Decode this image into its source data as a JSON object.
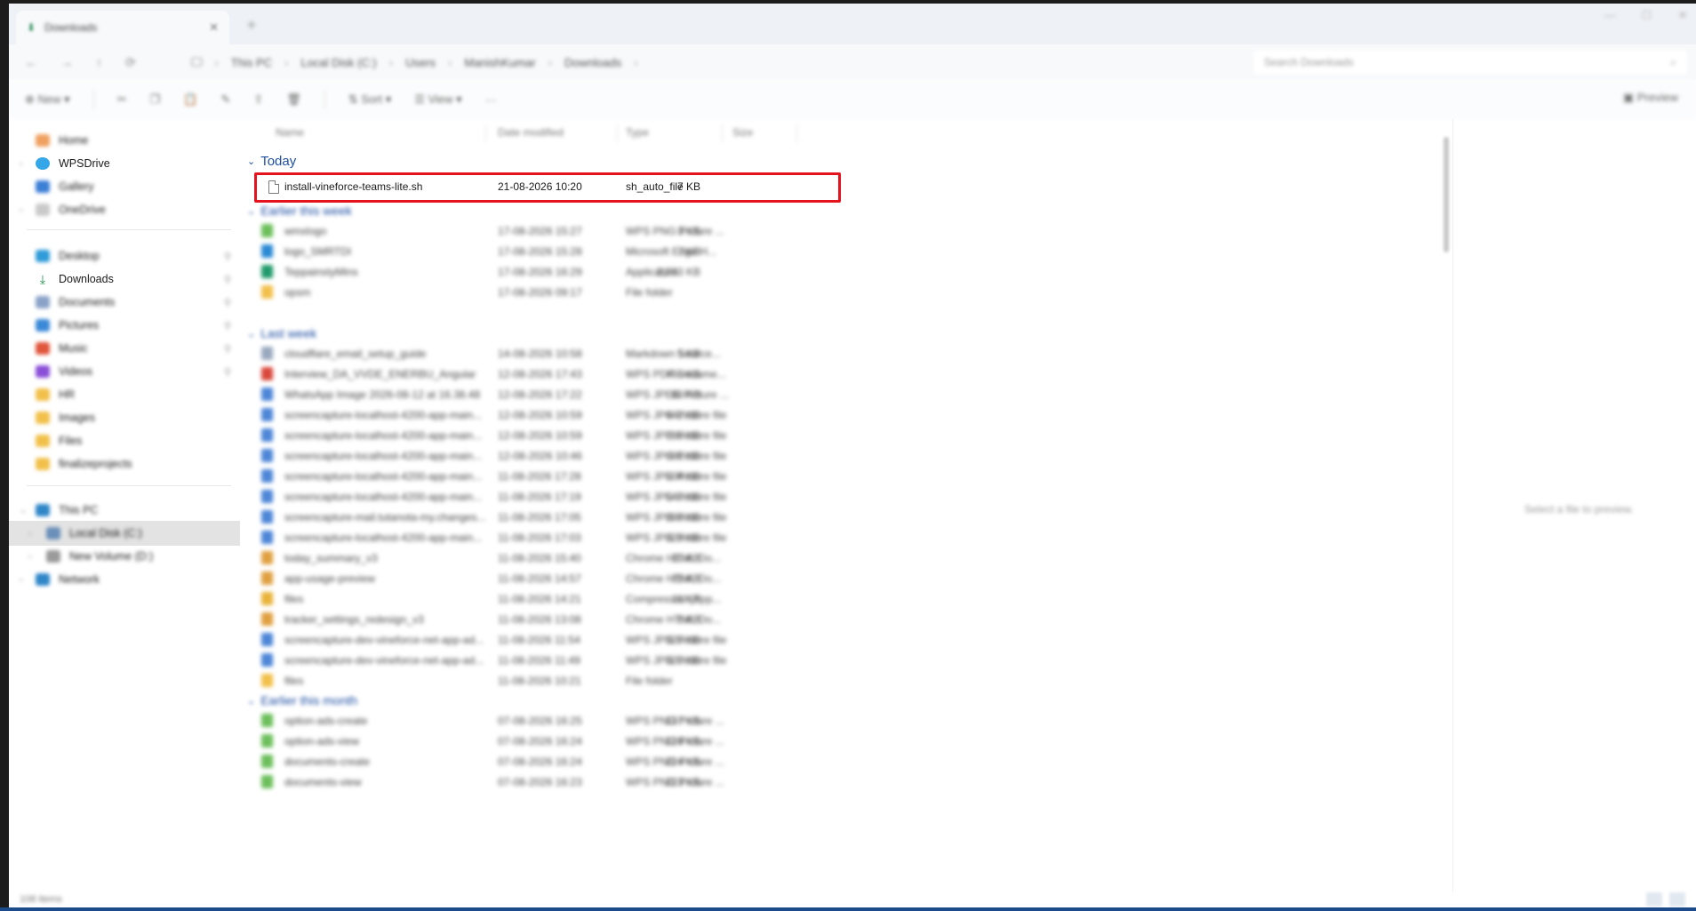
{
  "window": {
    "tab_title": "Downloads",
    "tab_close": "✕",
    "new_tab": "+",
    "controls": [
      "—",
      "☐",
      "✕"
    ]
  },
  "address": {
    "nav": [
      "←",
      "→",
      "↑",
      "⟳"
    ],
    "breadcrumb": [
      "This PC",
      "Local Disk (C:)",
      "Users",
      "ManishKumar",
      "Downloads"
    ],
    "search_placeholder": "Search Downloads"
  },
  "commands": {
    "new": "New",
    "sort": "Sort",
    "view": "View",
    "more": "···",
    "preview": "Preview"
  },
  "sidebar": {
    "home": "Home",
    "wpsdrive": "WPSDrive",
    "gallery": "Gallery",
    "onedrive": "OneDrive",
    "desktop": "Desktop",
    "downloads": "Downloads",
    "documents": "Documents",
    "pictures": "Pictures",
    "music": "Music",
    "videos": "Videos",
    "hr": "HR",
    "images": "Images",
    "files": "Files",
    "finalproject": "finalizeprojects",
    "thispc": "This PC",
    "localdisk": "Local Disk (C:)",
    "newvolume": "New Volume (D:)",
    "network": "Network"
  },
  "columns": {
    "name": "Name",
    "date": "Date modified",
    "type": "Type",
    "size": "Size"
  },
  "groups": {
    "today": "Today",
    "earlier_week": "Earlier this week",
    "last_week": "Last week",
    "earlier_month": "Earlier this month"
  },
  "today_file": {
    "name": "install-vineforce-teams-lite.sh",
    "date": "21-08-2026 10:20",
    "type": "sh_auto_file",
    "size": "7 KB"
  },
  "earlier_week_files": [
    {
      "name": "wmxlogo",
      "date": "17-08-2026 15:27",
      "type": "WPS PNG Picture ...",
      "size": "3 KB"
    },
    {
      "name": "logo_SMRTDI",
      "date": "17-08-2026 15:28",
      "type": "Microsoft Edge H...",
      "size": "7 KB"
    },
    {
      "name": "TeppainstyMins",
      "date": "17-08-2026 16:29",
      "type": "Application",
      "size": "2,233 KB"
    },
    {
      "name": "opsm",
      "date": "17-08-2026 09:17",
      "type": "File folder",
      "size": ""
    }
  ],
  "last_week_files": [
    {
      "name": "cloudflare_email_setup_guide",
      "date": "14-08-2026 10:58",
      "type": "Markdown Source...",
      "size": "5 KB"
    },
    {
      "name": "Interview_DA_VVDE_ENERBU_Angular",
      "date": "12-08-2026 17:43",
      "type": "WPS PDF Docume...",
      "size": "465 KB"
    },
    {
      "name": "WhatsApp Image 2026-08-12 at 16.38.48",
      "date": "12-08-2026 17:22",
      "type": "WPS JPEG Picture ...",
      "size": "80 KB"
    },
    {
      "name": "screencapture-localhost-4200-app-main...",
      "date": "12-08-2026 10:59",
      "type": "WPS JPG Picture file",
      "size": "442 KB"
    },
    {
      "name": "screencapture-localhost-4200-app-main...",
      "date": "12-08-2026 10:59",
      "type": "WPS JPG Picture file",
      "size": "785 KB"
    },
    {
      "name": "screencapture-localhost-4200-app-main...",
      "date": "12-08-2026 10:46",
      "type": "WPS JPG Picture file",
      "size": "691 KB"
    },
    {
      "name": "screencapture-localhost-4200-app-main...",
      "date": "11-08-2026 17:28",
      "type": "WPS JPG Picture file",
      "size": "504 KB"
    },
    {
      "name": "screencapture-localhost-4200-app-main...",
      "date": "11-08-2026 17:19",
      "type": "WPS JPG Picture file",
      "size": "540 KB"
    },
    {
      "name": "screencapture-mail.tutanota-my.changes...",
      "date": "11-08-2026 17:05",
      "type": "WPS JPG Picture file",
      "size": "393 KB"
    },
    {
      "name": "screencapture-localhost-4200-app-main...",
      "date": "11-08-2026 17:03",
      "type": "WPS JPG Picture file",
      "size": "323 KB"
    },
    {
      "name": "today_summary_v3",
      "date": "11-08-2026 15:40",
      "type": "Chrome HTML Do...",
      "size": "10 KB"
    },
    {
      "name": "app-usage-preview",
      "date": "11-08-2026 14:57",
      "type": "Chrome HTML Do...",
      "size": "21 KB"
    },
    {
      "name": "files",
      "date": "11-08-2026 14:21",
      "type": "Compressed (zipp...",
      "size": "11 KB"
    },
    {
      "name": "tracker_settings_redesign_v3",
      "date": "11-08-2026 13:08",
      "type": "Chrome HTML Do...",
      "size": "5 KB"
    },
    {
      "name": "screencapture-dev-vineforce-net-app-ad...",
      "date": "11-08-2026 11:54",
      "type": "WPS JPG Picture file",
      "size": "329 KB"
    },
    {
      "name": "screencapture-dev-vineforce-net-app-ad...",
      "date": "11-08-2026 11:49",
      "type": "WPS JPG Picture file",
      "size": "320 KB"
    },
    {
      "name": "files",
      "date": "11-08-2026 10:21",
      "type": "File folder",
      "size": ""
    }
  ],
  "earlier_month_files": [
    {
      "name": "option-ads-create",
      "date": "07-08-2026 16:25",
      "type": "WPS PNG Picture ...",
      "size": "137 KB"
    },
    {
      "name": "option-ads-view",
      "date": "07-08-2026 16:24",
      "type": "WPS PNG Picture ...",
      "size": "128 KB"
    },
    {
      "name": "documents-create",
      "date": "07-08-2026 16:24",
      "type": "WPS PNG Picture ...",
      "size": "224 KB"
    },
    {
      "name": "documents-view",
      "date": "07-08-2026 16:23",
      "type": "WPS PNG Picture ...",
      "size": "223 KB"
    }
  ],
  "preview": {
    "empty_text": "Select a file to preview."
  },
  "status": {
    "count": "108 items"
  },
  "colors": {
    "highlight": "#e5131d",
    "group_heading": "#1f4fa3"
  }
}
